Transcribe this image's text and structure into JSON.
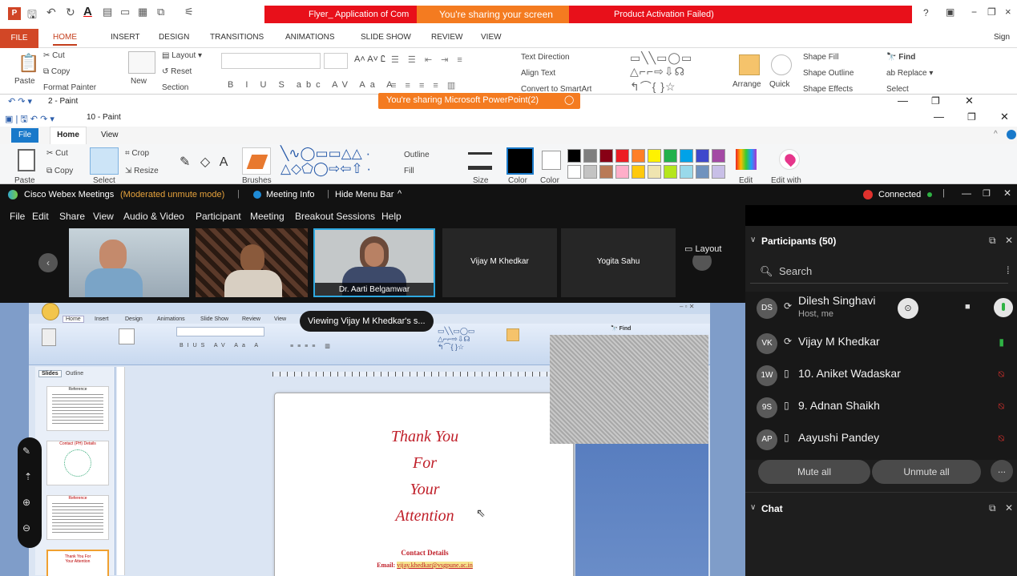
{
  "ppt": {
    "doc_title": "Flyer_ Application of Com",
    "sharing_notice": "You're sharing your screen",
    "activation_notice": "Product Activation Failed)",
    "right_controls": [
      "?",
      "−",
      "×"
    ],
    "sign_in": "Sign",
    "tabs": [
      "FILE",
      "HOME",
      "INSERT",
      "DESIGN",
      "TRANSITIONS",
      "ANIMATIONS",
      "SLIDE SHOW",
      "REVIEW",
      "VIEW"
    ],
    "ribbon": {
      "cut": "Cut",
      "copy": "Copy",
      "paste": "Paste",
      "format_painter": "Format Painter",
      "new": "New",
      "layout": "Layout",
      "reset": "Reset",
      "section": "Section",
      "text_direction": "Text Direction",
      "align_text": "Align Text",
      "convert_smartart": "Convert to SmartArt",
      "arrange": "Arrange",
      "quick": "Quick",
      "shape_fill": "Shape Fill",
      "shape_outline": "Shape Outline",
      "shape_effects": "Shape Effects",
      "find": "Find",
      "replace": "Replace",
      "select": "Select"
    },
    "share_banner": "You're sharing Microsoft PowerPoint(2)"
  },
  "paint": {
    "window2_title": "2 - Paint",
    "window10_title": "10 - Paint",
    "tabs": [
      "File",
      "Home",
      "View"
    ],
    "ribbon": {
      "paste": "Paste",
      "cut": "Cut",
      "copy": "Copy",
      "select": "Select",
      "crop": "Crop",
      "resize": "Resize",
      "brushes": "Brushes",
      "outline": "Outline",
      "fill": "Fill",
      "size": "Size",
      "color1": "Color",
      "color2": "Color",
      "edit_colors": "Edit",
      "edit_with": "Edit with"
    },
    "palette": [
      "#000000",
      "#7f7f7f",
      "#880015",
      "#ed1c24",
      "#ff7f27",
      "#fff200",
      "#22b14c",
      "#00a2e8",
      "#3f48cc",
      "#a349a4",
      "#ffffff",
      "#c3c3c3",
      "#b97a57",
      "#ffaec9",
      "#ffc90e",
      "#efe4b0",
      "#b5e61d",
      "#99d9ea",
      "#7092be",
      "#c8bfe7"
    ]
  },
  "webex": {
    "app_name": "Cisco Webex Meetings",
    "mode": "(Moderated unmute mode)",
    "meeting_info": "Meeting Info",
    "hide_menu": "Hide Menu Bar",
    "connected": "Connected",
    "menu": [
      "File",
      "Edit",
      "Share",
      "View",
      "Audio & Video",
      "Participant",
      "Meeting",
      "Breakout Sessions",
      "Help"
    ],
    "videos": [
      {
        "name": ""
      },
      {
        "name": ""
      },
      {
        "name": "Dr. Aarti Belgamwar"
      },
      {
        "name": "Vijay M Khedkar"
      },
      {
        "name": "Yogita Sahu"
      }
    ],
    "layout_label": "Layout",
    "viewing_tooltip": "Viewing Vijay M Khedkar's s...",
    "participants_title": "Participants (50)",
    "search_placeholder": "Search",
    "participants": [
      {
        "initials": "DS",
        "name": "Dilesh Singhavi",
        "role": "Host, me",
        "mic": "on"
      },
      {
        "initials": "VK",
        "name": "Vijay M Khedkar",
        "role": "",
        "mic": "on"
      },
      {
        "initials": "1W",
        "name": "10. Aniket Wadaskar",
        "role": "",
        "mic": "muted"
      },
      {
        "initials": "9S",
        "name": "9. Adnan Shaikh",
        "role": "",
        "mic": "muted"
      },
      {
        "initials": "AP",
        "name": "Aayushi Pandey",
        "role": "",
        "mic": "muted"
      }
    ],
    "mute_all": "Mute all",
    "unmute_all": "Unmute all",
    "more": "...",
    "chat_title": "Chat"
  },
  "shared_ppt": {
    "tabs": [
      "Home",
      "Insert",
      "Design",
      "Animations",
      "Slide Show",
      "Review",
      "View"
    ],
    "panel_tabs": [
      "Slides",
      "Outline"
    ],
    "slide_lines": [
      "Thank You",
      "For",
      "Your",
      "Attention"
    ],
    "contact_title": "Contact Details",
    "email_label": "Email:",
    "email_value": "vijay.khedkar@vsgpune.ac.in",
    "thumbs": [
      "Reference",
      "Contact (PH) Details",
      "Reference",
      "Thank You For Your Attention"
    ]
  },
  "colors": {
    "webex_green": "#2fb344",
    "muted_red": "#e0312d",
    "share_orange": "#f47b20",
    "title_red": "#e8101a"
  }
}
